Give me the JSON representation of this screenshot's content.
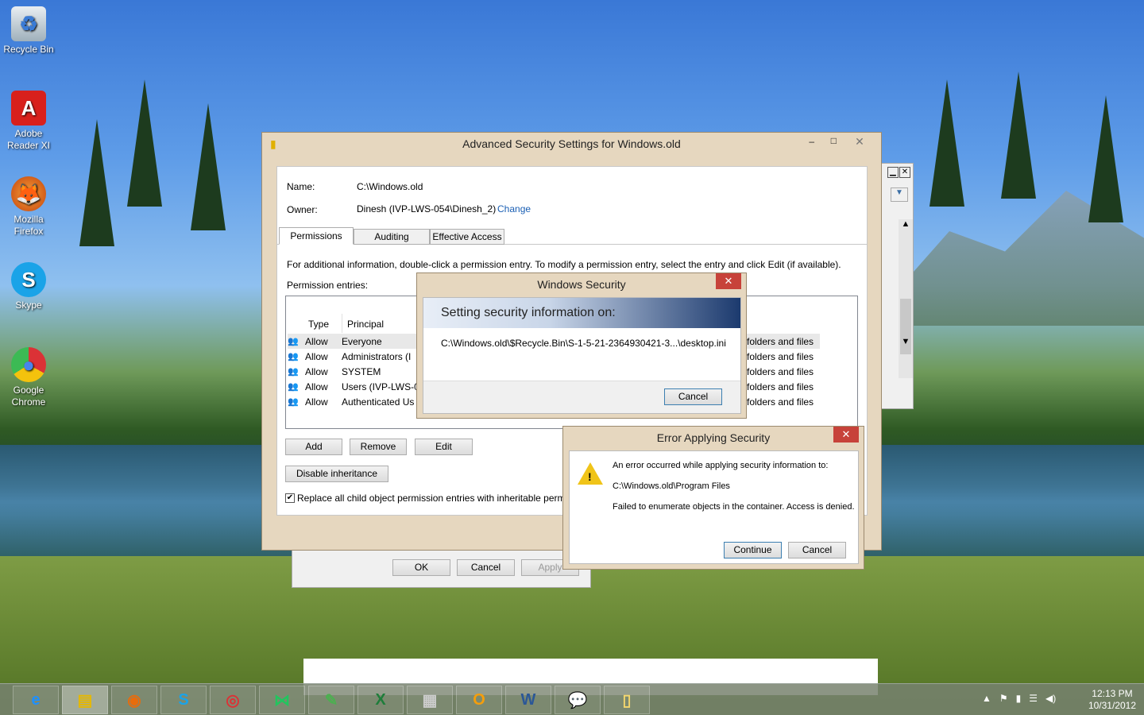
{
  "desktop": {
    "icons": [
      {
        "label": "Recycle Bin",
        "icon": "recycle-bin-icon"
      },
      {
        "label": "Adobe Reader XI",
        "icon": "adobe-reader-icon"
      },
      {
        "label": "Mozilla Firefox",
        "icon": "firefox-icon"
      },
      {
        "label": "Skype",
        "icon": "skype-icon"
      },
      {
        "label": "Google Chrome",
        "icon": "chrome-icon"
      }
    ]
  },
  "adv": {
    "title": "Advanced Security Settings for Windows.old",
    "name_label": "Name:",
    "name_value": "C:\\Windows.old",
    "owner_label": "Owner:",
    "owner_value": "Dinesh (IVP-LWS-054\\Dinesh_2)",
    "change_link": "Change",
    "tabs": [
      "Permissions",
      "Auditing",
      "Effective Access"
    ],
    "info": "For additional information, double-click a permission entry. To modify a permission entry, select the entry and click Edit (if available).",
    "entries_label": "Permission entries:",
    "col_type": "Type",
    "col_principal": "Principal",
    "rows": [
      {
        "type": "Allow",
        "principal": "Everyone",
        "applies": "folders and files"
      },
      {
        "type": "Allow",
        "principal": "Administrators (I",
        "applies": "folders and files"
      },
      {
        "type": "Allow",
        "principal": "SYSTEM",
        "applies": "folders and files"
      },
      {
        "type": "Allow",
        "principal": "Users (IVP-LWS-0",
        "applies": "folders and files"
      },
      {
        "type": "Allow",
        "principal": "Authenticated Us",
        "applies": "folders and files"
      }
    ],
    "add": "Add",
    "remove": "Remove",
    "edit": "Edit",
    "disable_inheritance": "Disable inheritance",
    "replace_checkbox": "Replace all child object permission entries with inheritable perm",
    "ok": "OK",
    "cancel": "Cancel",
    "apply": "Apply"
  },
  "winsec": {
    "title": "Windows Security",
    "banner": "Setting security information on:",
    "path": "C:\\Windows.old\\$Recycle.Bin\\S-1-5-21-2364930421-3...\\desktop.ini",
    "cancel": "Cancel"
  },
  "err": {
    "title": "Error Applying Security",
    "line1": "An error occurred while applying security information to:",
    "line2": "C:\\Windows.old\\Program Files",
    "line3": "Failed to enumerate objects in the container. Access is denied.",
    "continue": "Continue",
    "cancel": "Cancel"
  },
  "taskbar": {
    "apps": [
      "internet-explorer-icon",
      "file-explorer-icon",
      "firefox-icon",
      "skype-icon",
      "chrome-icon",
      "visual-studio-icon",
      "project-icon",
      "excel-icon",
      "picture-icon",
      "outlook-icon",
      "word-icon",
      "gtalk-icon",
      "folder-icon"
    ],
    "time": "12:13 PM",
    "date": "10/31/2012"
  },
  "colors": {
    "close": "#c7423a",
    "link": "#1a5fb4",
    "banner_start": "#e8eef7",
    "banner_end": "#1c3a6e"
  }
}
